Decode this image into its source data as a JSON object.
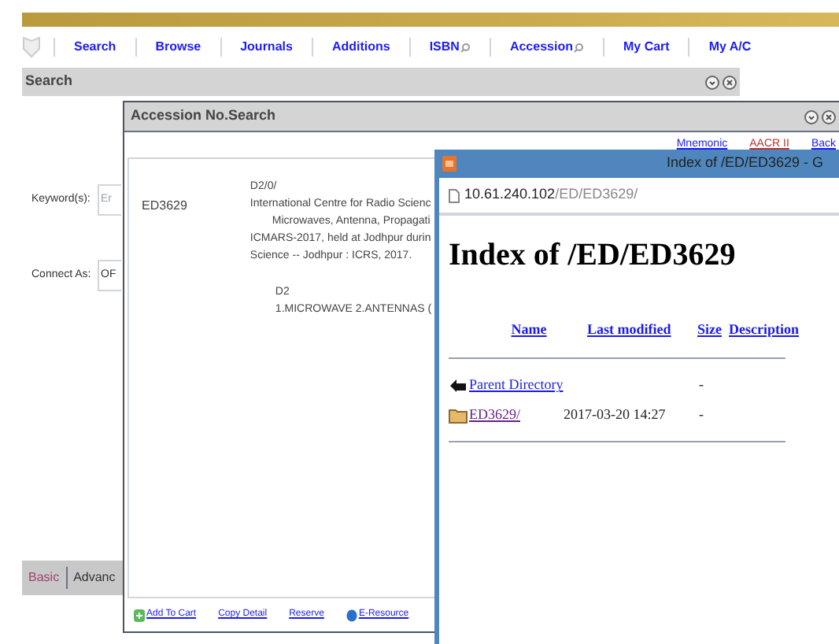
{
  "nav": [
    {
      "label": "Search",
      "search_icon": false
    },
    {
      "label": "Browse",
      "search_icon": false
    },
    {
      "label": "Journals",
      "search_icon": false
    },
    {
      "label": "Additions",
      "search_icon": false
    },
    {
      "label": "ISBN",
      "search_icon": true
    },
    {
      "label": "Accession",
      "search_icon": true
    },
    {
      "label": "My Cart",
      "search_icon": false
    },
    {
      "label": "My A/C",
      "search_icon": false
    }
  ],
  "search_panel": {
    "title": "Search",
    "fields": [
      {
        "label": "Keyword(s):",
        "placeholder": "Er"
      },
      {
        "label": "Connect As:",
        "value": "OF"
      }
    ],
    "tabs": [
      {
        "label": "Basic",
        "selected": true
      },
      {
        "label": "Advanc",
        "selected": false
      }
    ]
  },
  "accession_window": {
    "title": "Accession No.Search",
    "links": [
      "Mnemonic",
      "AACR II",
      "Back"
    ],
    "record": {
      "accession": "ED3629",
      "lines": [
        {
          "text": "D2/0/",
          "indent": false
        },
        {
          "text": "International Centre for Radio Scienc",
          "indent": false
        },
        {
          "text": "Microwaves, Antenna, Propagati",
          "indent": true
        },
        {
          "text": "ICMARS-2017, held at Jodhpur durin",
          "indent": false
        },
        {
          "text": "Science -- Jodhpur : ICRS, 2017.",
          "indent": false
        }
      ],
      "class": "D2",
      "subjects": "1.MICROWAVE 2.ANTENNAS ("
    },
    "actions": [
      {
        "label": "Add To Cart",
        "kind": "cart"
      },
      {
        "label": "Copy Detail",
        "kind": "plain"
      },
      {
        "label": "Reserve",
        "kind": "plain"
      },
      {
        "label": "E-Resource",
        "kind": "eresource"
      }
    ]
  },
  "browser": {
    "title": "Index of /ED/ED3629 - G",
    "address_host": "10.61.240.102",
    "address_path": "/ED/ED3629/",
    "heading": "Index of /ED/ED3629",
    "columns": [
      "Name",
      "Last modified",
      "Size",
      "Description"
    ],
    "rows": [
      {
        "kind": "parent",
        "name": "Parent Directory",
        "modified": "",
        "size": "-"
      },
      {
        "kind": "folder",
        "name": "ED3629/",
        "modified": "2017-03-20 14:27",
        "size": "-"
      }
    ]
  }
}
